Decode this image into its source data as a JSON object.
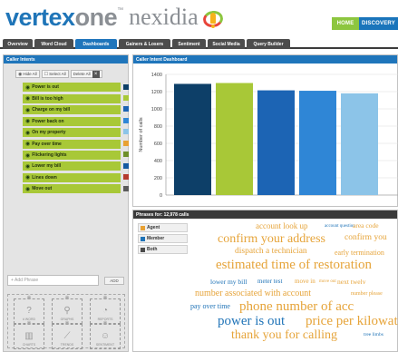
{
  "header": {
    "logo": {
      "part1": "vertex",
      "part2": "one",
      "tm": "™",
      "brand": "nexidia"
    },
    "home_label": "HOME",
    "discovery_label": "DISCOVERY"
  },
  "tabs": [
    {
      "label": "Overview",
      "active": false
    },
    {
      "label": "Word Cloud",
      "active": false
    },
    {
      "label": "Dashboards",
      "active": true
    },
    {
      "label": "Gainers & Losers",
      "active": false
    },
    {
      "label": "Sentiment",
      "active": false
    },
    {
      "label": "Social Media",
      "active": false
    },
    {
      "label": "Query Builder",
      "active": false
    }
  ],
  "left_panel": {
    "title": "Caller Intents",
    "hide_all": "Hide All",
    "select_all": "Select All",
    "delete_all": "Delete All",
    "intents": [
      {
        "label": "Power is out",
        "color": "#0d3f68"
      },
      {
        "label": "Bill is too high",
        "color": "#a8c837"
      },
      {
        "label": "Charge on my bill",
        "color": "#1c64b4"
      },
      {
        "label": "Power back on",
        "color": "#2f86d6"
      },
      {
        "label": "On my property",
        "color": "#8cc4e8"
      },
      {
        "label": "Pay over time",
        "color": "#e8a133"
      },
      {
        "label": "Flickering lights",
        "color": "#6e8f2a"
      },
      {
        "label": "Lower my bill",
        "color": "#165aa1"
      },
      {
        "label": "Lines down",
        "color": "#b53a2e"
      },
      {
        "label": "Move out",
        "color": "#5a5a5a"
      }
    ],
    "add_phrase_placeholder": "+ Add Phrase",
    "add_label": "ADD",
    "widgets": [
      {
        "label": "# WORD",
        "icon": "?"
      },
      {
        "label": "GRAPHS",
        "icon": "⚲"
      },
      {
        "label": "REPORTS",
        "icon": "◔"
      },
      {
        "label": "CHARTS",
        "icon": "▥"
      },
      {
        "label": "TRENDS",
        "icon": "⟋"
      },
      {
        "label": "SENTIMENT",
        "icon": "☺"
      }
    ]
  },
  "chart_panel": {
    "title": "Caller Intent Dashboard"
  },
  "chart_data": {
    "type": "bar",
    "ylabel": "Number of calls",
    "xlabel": "",
    "ylim": [
      0,
      1400
    ],
    "yticks": [
      0,
      200,
      400,
      600,
      800,
      1000,
      1200,
      1400
    ],
    "grid": true,
    "series": [
      {
        "values": [
          1290,
          1300,
          1215,
          1210,
          1180
        ],
        "colors": [
          "#0d3f68",
          "#a8c837",
          "#1c64b4",
          "#2f86d6",
          "#8cc4e8"
        ]
      }
    ]
  },
  "phrases_panel": {
    "title": "Phrases for: 12,978 calls",
    "legend": [
      {
        "label": "Agent",
        "color": "#e8a133"
      },
      {
        "label": "Member",
        "color": "#1f73b7"
      },
      {
        "label": "Both",
        "color": "#4a4a4a"
      }
    ],
    "words": [
      {
        "text": "account look up",
        "color": "orange"
      },
      {
        "text": "account question",
        "color": "blue"
      },
      {
        "text": "area code",
        "color": "orange"
      },
      {
        "text": "confirm your address",
        "color": "orange"
      },
      {
        "text": "confirm you",
        "color": "orange"
      },
      {
        "text": "dispatch a technician",
        "color": "orange"
      },
      {
        "text": "early termination",
        "color": "orange"
      },
      {
        "text": "estimated time of restoration",
        "color": "orange"
      },
      {
        "text": "lower my bill",
        "color": "blue"
      },
      {
        "text": "meter test",
        "color": "blue"
      },
      {
        "text": "move in",
        "color": "orange"
      },
      {
        "text": "move out",
        "color": "orange"
      },
      {
        "text": "next twelv",
        "color": "orange"
      },
      {
        "text": "number associated with account",
        "color": "orange"
      },
      {
        "text": "number please",
        "color": "orange"
      },
      {
        "text": "pay over time",
        "color": "blue"
      },
      {
        "text": "phone number of acc",
        "color": "orange"
      },
      {
        "text": "power is out",
        "color": "blue"
      },
      {
        "text": "price per kilowat",
        "color": "orange"
      },
      {
        "text": "thank you for calling",
        "color": "orange"
      },
      {
        "text": "tree limbs",
        "color": "blue"
      }
    ]
  }
}
